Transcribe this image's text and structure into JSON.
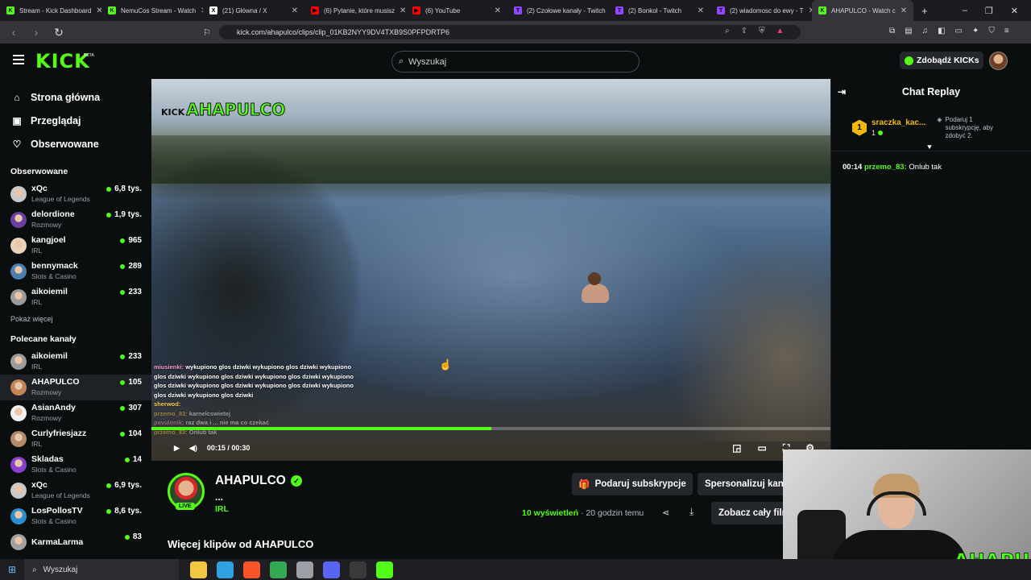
{
  "browser": {
    "tabs": [
      {
        "title": "Stream - Kick Dashboard",
        "color": "#53fc18",
        "letter": "K"
      },
      {
        "title": "NemuCos Stream - Watch",
        "color": "#53fc18",
        "letter": "K"
      },
      {
        "title": "(21) Główna / X",
        "color": "#ffffff",
        "letter": "X"
      },
      {
        "title": "(6) Pytanie, które musisz",
        "color": "#ff0000",
        "letter": "▶"
      },
      {
        "title": "(6) YouTube",
        "color": "#ff0000",
        "letter": "▶"
      },
      {
        "title": "(2) Czołowe kanały - Twitch",
        "color": "#9146ff",
        "letter": "T"
      },
      {
        "title": "(2) Bonkol - Twitch",
        "color": "#9146ff",
        "letter": "T"
      },
      {
        "title": "(2) wiadomosc do ewy - T",
        "color": "#9146ff",
        "letter": "T"
      },
      {
        "title": "AHAPULCO - Watch c",
        "color": "#53fc18",
        "letter": "K",
        "active": true
      }
    ],
    "url": "kick.com/ahapulco/clips/clip_01KB2NYY9DV4TXB9S0PFPDRTP6",
    "new_tab": "+",
    "window_controls": {
      "minimize": "–",
      "restore": "❐",
      "close": "✕"
    }
  },
  "header": {
    "logo": "KICK",
    "beta": "BETA",
    "search_placeholder": "Wyszukaj",
    "kicks_button": "Zdobądź KICKs"
  },
  "sidebar": {
    "nav": [
      {
        "label": "Strona główna",
        "icon": "⌂"
      },
      {
        "label": "Przeglądaj",
        "icon": "▣"
      },
      {
        "label": "Obserwowane",
        "icon": "♡"
      }
    ],
    "followed_title": "Obserwowane",
    "followed": [
      {
        "name": "xQc",
        "category": "League of Legends",
        "viewers": "6,8 tys.",
        "color": "#c9c9c9"
      },
      {
        "name": "delordione",
        "category": "Rozmowy",
        "viewers": "1,9 tys.",
        "color": "#6a3fa0"
      },
      {
        "name": "kangjoel",
        "category": "IRL",
        "viewers": "965",
        "color": "#e8d2b8"
      },
      {
        "name": "bennymack",
        "category": "Slots & Casino",
        "viewers": "289",
        "color": "#4a7fb0"
      },
      {
        "name": "aikoiemil",
        "category": "IRL",
        "viewers": "233",
        "color": "#9a9a9a"
      }
    ],
    "show_more": "Pokaż więcej",
    "recommended_title": "Polecane kanały",
    "recommended": [
      {
        "name": "aikoiemil",
        "category": "IRL",
        "viewers": "233",
        "color": "#9a9a9a"
      },
      {
        "name": "AHAPULCO",
        "category": "Rozmowy",
        "viewers": "105",
        "color": "#c08457",
        "active": true
      },
      {
        "name": "AsianAndy",
        "category": "Rozmowy",
        "viewers": "307",
        "color": "#f0f0f0"
      },
      {
        "name": "Curlyfriesjazz",
        "category": "IRL",
        "viewers": "104",
        "color": "#b08a6a"
      },
      {
        "name": "Skladas",
        "category": "Slots & Casino",
        "viewers": "14",
        "color": "#8a3fd0"
      },
      {
        "name": "xQc",
        "category": "League of Legends",
        "viewers": "6,9 tys.",
        "color": "#c9c9c9"
      },
      {
        "name": "LosPollosTV",
        "category": "Slots & Casino",
        "viewers": "8,6 tys.",
        "color": "#2a8fd0"
      },
      {
        "name": "KarmaLarma",
        "category": "",
        "viewers": "83",
        "color": "#a0a0a0"
      }
    ]
  },
  "video": {
    "overlay_logo_prefix": "KICK",
    "overlay_logo": "AHAPULCO",
    "chat_overlay": [
      {
        "user": "miusienki:",
        "text": "wykupiono glos dziwki wykupiono glos dziwki wykupiono glos dziwki wykupiono glos dziwki wykupiono glos dziwki wykupiono glos dziwki wykupiono glos dziwki wykupiono glos dziwki wykupiono glos dziwki wykupiono glos dziwki"
      },
      {
        "user": "sherwod:",
        "text": ""
      },
      {
        "user": "przemo_83:",
        "text": "karnelcswietej"
      },
      {
        "user": "pavulonik:",
        "text": "raz dwa i ... nie ma co czekać"
      },
      {
        "user": "przemo_83:",
        "text": "Onlub tak"
      }
    ],
    "progress": 0.5,
    "time": "00:15 / 00:30"
  },
  "channel": {
    "name": "AHAPULCO",
    "title": "...",
    "category": "IRL",
    "live_label": "LIVE",
    "gift_button": "Podaruj subskrypcje",
    "customize_button": "Spersonalizuj kanał",
    "views_count": "10",
    "views_label": "wyświetleń",
    "time_ago": "· 20 godzin temu",
    "full_button": "Zobacz cały film",
    "more_clips": "Więcej klipów od AHAPULCO"
  },
  "chat": {
    "title": "Chat Replay",
    "pinned_badge": "1",
    "pinned_user": "sraczka_kac...",
    "pinned_count": "1",
    "pinned_hint": "Podaruj 1 subskrypcję, aby zdobyć 2.",
    "messages": [
      {
        "time": "00:14",
        "user": "przemo_83:",
        "text": "Onlub tak"
      }
    ]
  },
  "webcam": {
    "brand": "AHAPULCO"
  },
  "taskbar": {
    "search": "Wyszukaj",
    "apps": [
      {
        "name": "explorer",
        "color": "#f2c744"
      },
      {
        "name": "edge",
        "color": "#2fa1e0"
      },
      {
        "name": "brave",
        "color": "#fb542b"
      },
      {
        "name": "chrome",
        "color": "#34a853"
      },
      {
        "name": "files",
        "color": "#9aa0a6"
      },
      {
        "name": "discord",
        "color": "#5865f2"
      },
      {
        "name": "obs",
        "color": "#3a3a3a"
      },
      {
        "name": "kick",
        "color": "#53fc18"
      }
    ]
  }
}
